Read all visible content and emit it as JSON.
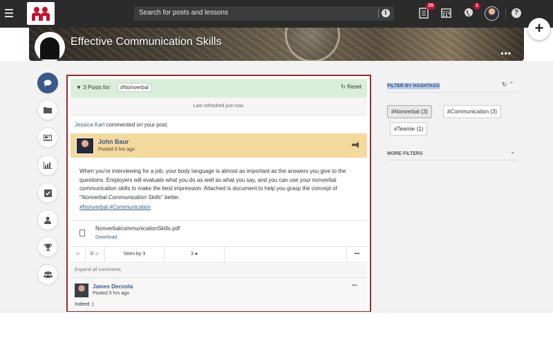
{
  "topbar": {
    "search_placeholder": "Search for posts and lessons",
    "info_glyph": "i",
    "notifications_badge": "25",
    "globe_badge": "1",
    "help_glyph": "?",
    "plus_glyph": "+"
  },
  "banner": {
    "title": "Effective Communication Skills",
    "more_glyph": "•••"
  },
  "feed": {
    "filter_label": "3 Posts for:",
    "filter_tag": "#Nonverbal",
    "reset_label": "Reset",
    "refreshed_text": "Last refreshed just now.",
    "notification_name": "Jessica Karl",
    "notification_text": " commented on your post.",
    "post": {
      "author": "John Baur",
      "time": "Posted 5 hrs ago",
      "body_line1": "When you're interviewing for a job, your body language is almost as important as the answers you give to the questions. Employers will evaluate what you do as well as what you say, and you can use your nonverbal communication skills to make the best impression. Attached is document to help you grasp the concept of \"",
      "body_italic": "Nonverbal Communication Skills",
      "body_end": "\" better.",
      "hashtag1": "#Nonverbal",
      "hashtag2": "#Communication",
      "attachment_name": "NonverbalcommunicationSkills.pdf",
      "attachment_action": "Download",
      "reactions_icon": "☺",
      "reaction_count": "0 ☺",
      "seen_by": "Seen by 3",
      "comment_count": "3",
      "more_glyph": "•••"
    },
    "expand_comments": "Expand all comments",
    "comment": {
      "author": "James Decosta",
      "time": "Posted 5 hrs ago",
      "text": "Indeed :)",
      "more_glyph": "•••"
    }
  },
  "right_panel": {
    "heading": "FILTER BY HASHTAGS",
    "tags": [
      "#Nonverbal (3)",
      "#Communication (3)",
      "#Teamie (1)"
    ],
    "more_filters": "MORE FILTERS"
  }
}
